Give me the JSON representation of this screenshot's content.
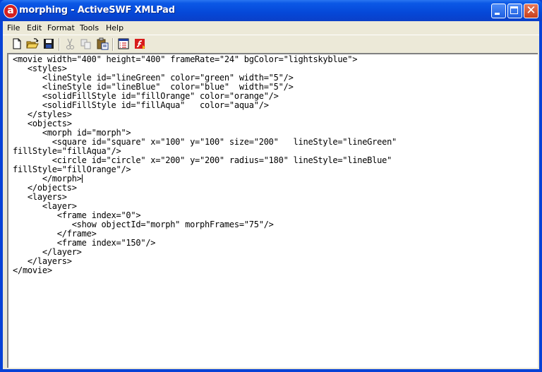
{
  "window": {
    "title": "morphing - ActiveSWF XMLPad",
    "app_icon_letter": "a"
  },
  "menu": {
    "items": [
      "File",
      "Edit",
      "Format",
      "Tools",
      "Help"
    ]
  },
  "toolbar": {
    "buttons": [
      {
        "name": "new",
        "enabled": true
      },
      {
        "name": "open",
        "enabled": true
      },
      {
        "name": "save",
        "enabled": true
      },
      {
        "name": "cut",
        "enabled": false
      },
      {
        "name": "copy",
        "enabled": false
      },
      {
        "name": "paste",
        "enabled": true
      },
      {
        "name": "properties",
        "enabled": true
      },
      {
        "name": "compile-flash",
        "enabled": true
      }
    ]
  },
  "editor": {
    "lines": [
      "<movie width=\"400\" height=\"400\" frameRate=\"24\" bgColor=\"lightskyblue\">",
      "   <styles>",
      "      <lineStyle id=\"lineGreen\" color=\"green\" width=\"5\"/>",
      "      <lineStyle id=\"lineBlue\"  color=\"blue\"  width=\"5\"/>",
      "      <solidFillStyle id=\"fillOrange\" color=\"orange\"/>",
      "      <solidFillStyle id=\"fillAqua\"   color=\"aqua\"/>",
      "   </styles>",
      "   <objects>",
      "      <morph id=\"morph\">",
      "        <square id=\"square\" x=\"100\" y=\"100\" size=\"200\"   lineStyle=\"lineGreen\"",
      "fillStyle=\"fillAqua\"/>",
      "        <circle id=\"circle\" x=\"200\" y=\"200\" radius=\"180\" lineStyle=\"lineBlue\"",
      "fillStyle=\"fillOrange\"/>",
      "      </morph>",
      "   </objects>",
      "   <layers>",
      "      <layer>",
      "         <frame index=\"0\">",
      "            <show objectId=\"morph\" morphFrames=\"75\"/>",
      "         </frame>",
      "         <frame index=\"150\"/>",
      "      </layer>",
      "   </layers>",
      "</movie>"
    ],
    "caret_line": 13
  }
}
